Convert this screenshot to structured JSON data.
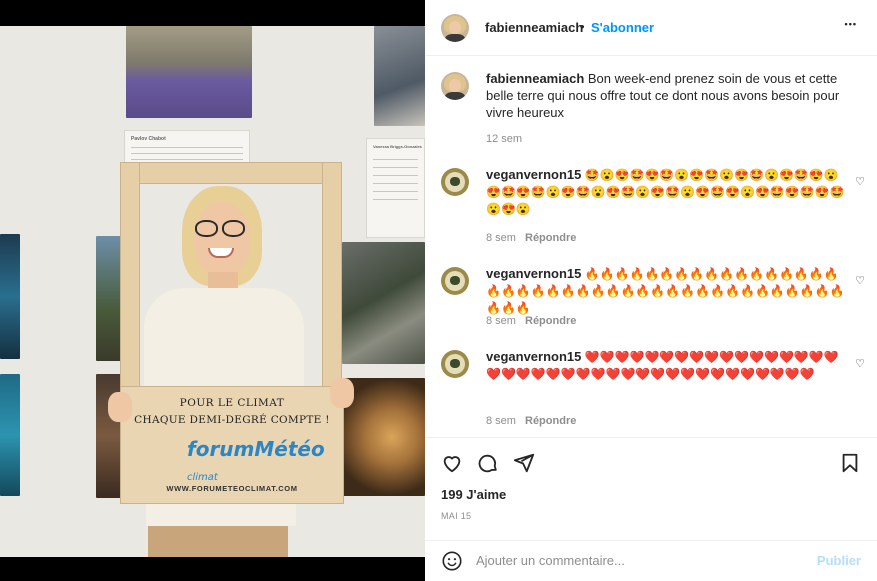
{
  "post": {
    "author": "fabienneamiach",
    "separator": "•",
    "follow_label": "S'abonner",
    "more_label": "•••",
    "caption_author": "fabienneamiach",
    "caption_text": "Bon week-end prenez soin de vous et cette belle terre qui nous offre tout ce dont nous avons besoin pour vivre heureux",
    "caption_time": "12 sem",
    "likes": "199 J'aime",
    "date": "MAI 15"
  },
  "photo": {
    "sign_line1": "POUR LE CLIMAT",
    "sign_line2": "CHAQUE DEMI-DEGRÉ COMPTE !",
    "sign_logo": "forumMétéo",
    "sign_logo_sub": "climat",
    "sign_url": "WWW.FORUMETEOCLIMAT.COM",
    "note1_title": "Pavlov Chabot",
    "note2_title": "Vanessa Briggs-Gonzales"
  },
  "comments": [
    {
      "user": "veganvernon15",
      "text": "🤩😮😍🤩😍🤩😮😍🤩😮😍🤩😮😍🤩😍😮😍🤩😍🤩😮😍🤩😮😍🤩😮😍🤩😮😍🤩😍😮😍🤩😍🤩😍🤩😮😍😮",
      "time": "8 sem",
      "reply": "Répondre"
    },
    {
      "user": "veganvernon15",
      "text": "🔥🔥🔥🔥🔥🔥🔥🔥🔥🔥🔥🔥🔥🔥🔥🔥🔥🔥🔥🔥🔥🔥🔥🔥🔥🔥🔥🔥🔥🔥🔥🔥🔥🔥🔥🔥🔥🔥🔥🔥🔥🔥🔥🔥",
      "time": "8 sem",
      "reply": "Répondre"
    },
    {
      "user": "veganvernon15",
      "text": "❤️❤️❤️❤️❤️❤️❤️❤️❤️❤️❤️❤️❤️❤️❤️❤️❤️❤️❤️❤️❤️❤️❤️❤️❤️❤️❤️❤️❤️❤️❤️❤️❤️❤️❤️❤️❤️❤️❤️",
      "time": "8 sem",
      "reply": "Répondre"
    }
  ],
  "comment_box": {
    "placeholder": "Ajouter un commentaire...",
    "publish_label": "Publier"
  },
  "icons": {
    "like": "heart-icon",
    "comment": "comment-icon",
    "share": "share-icon",
    "save": "bookmark-icon",
    "emoji": "emoji-icon",
    "comment_like": "heart-icon"
  },
  "colors": {
    "link_blue": "#0095f6",
    "publish_disabled": "#b2dffc",
    "muted": "#8e8e8e"
  }
}
